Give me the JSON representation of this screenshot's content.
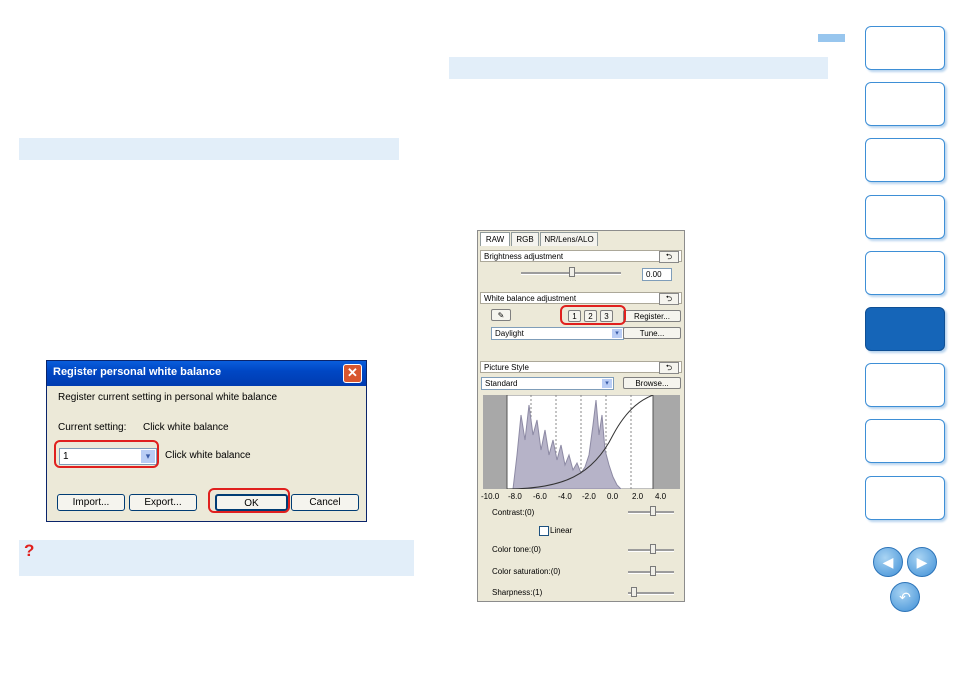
{
  "dialog": {
    "title": "Register personal white balance",
    "close_glyph": "✕",
    "message": "Register current setting in personal white balance",
    "current_setting_label": "Current setting:",
    "current_setting_value": "Click white balance",
    "select_value": "1",
    "select_label": "Click white balance",
    "buttons": {
      "import": "Import...",
      "export": "Export...",
      "ok": "OK",
      "cancel": "Cancel"
    }
  },
  "help_icon": "?",
  "panel": {
    "tabs": [
      "RAW",
      "RGB",
      "NR/Lens/ALO"
    ],
    "brightness": {
      "title": "Brightness adjustment",
      "value": "0.00",
      "level": 0.5
    },
    "white_balance": {
      "title": "White balance adjustment",
      "slots": [
        "1",
        "2",
        "3"
      ],
      "register": "Register...",
      "preset": "Daylight",
      "tune": "Tune..."
    },
    "picture_style": {
      "title": "Picture Style",
      "preset": "Standard",
      "browse": "Browse...",
      "axis_ticks": [
        "-10.0",
        "-8.0",
        "-6.0",
        "-4.0",
        "-2.0",
        "0.0",
        "2.0",
        "4.0"
      ],
      "contrast": "Contrast:(0)",
      "linear": "Linear",
      "color_tone": "Color tone:(0)",
      "color_saturation": "Color saturation:(0)",
      "sharpness": "Sharpness:(1)"
    }
  },
  "colors": {
    "accent": "#1565b8",
    "highlight": "#e0201e",
    "bar": "#e2eef9"
  }
}
